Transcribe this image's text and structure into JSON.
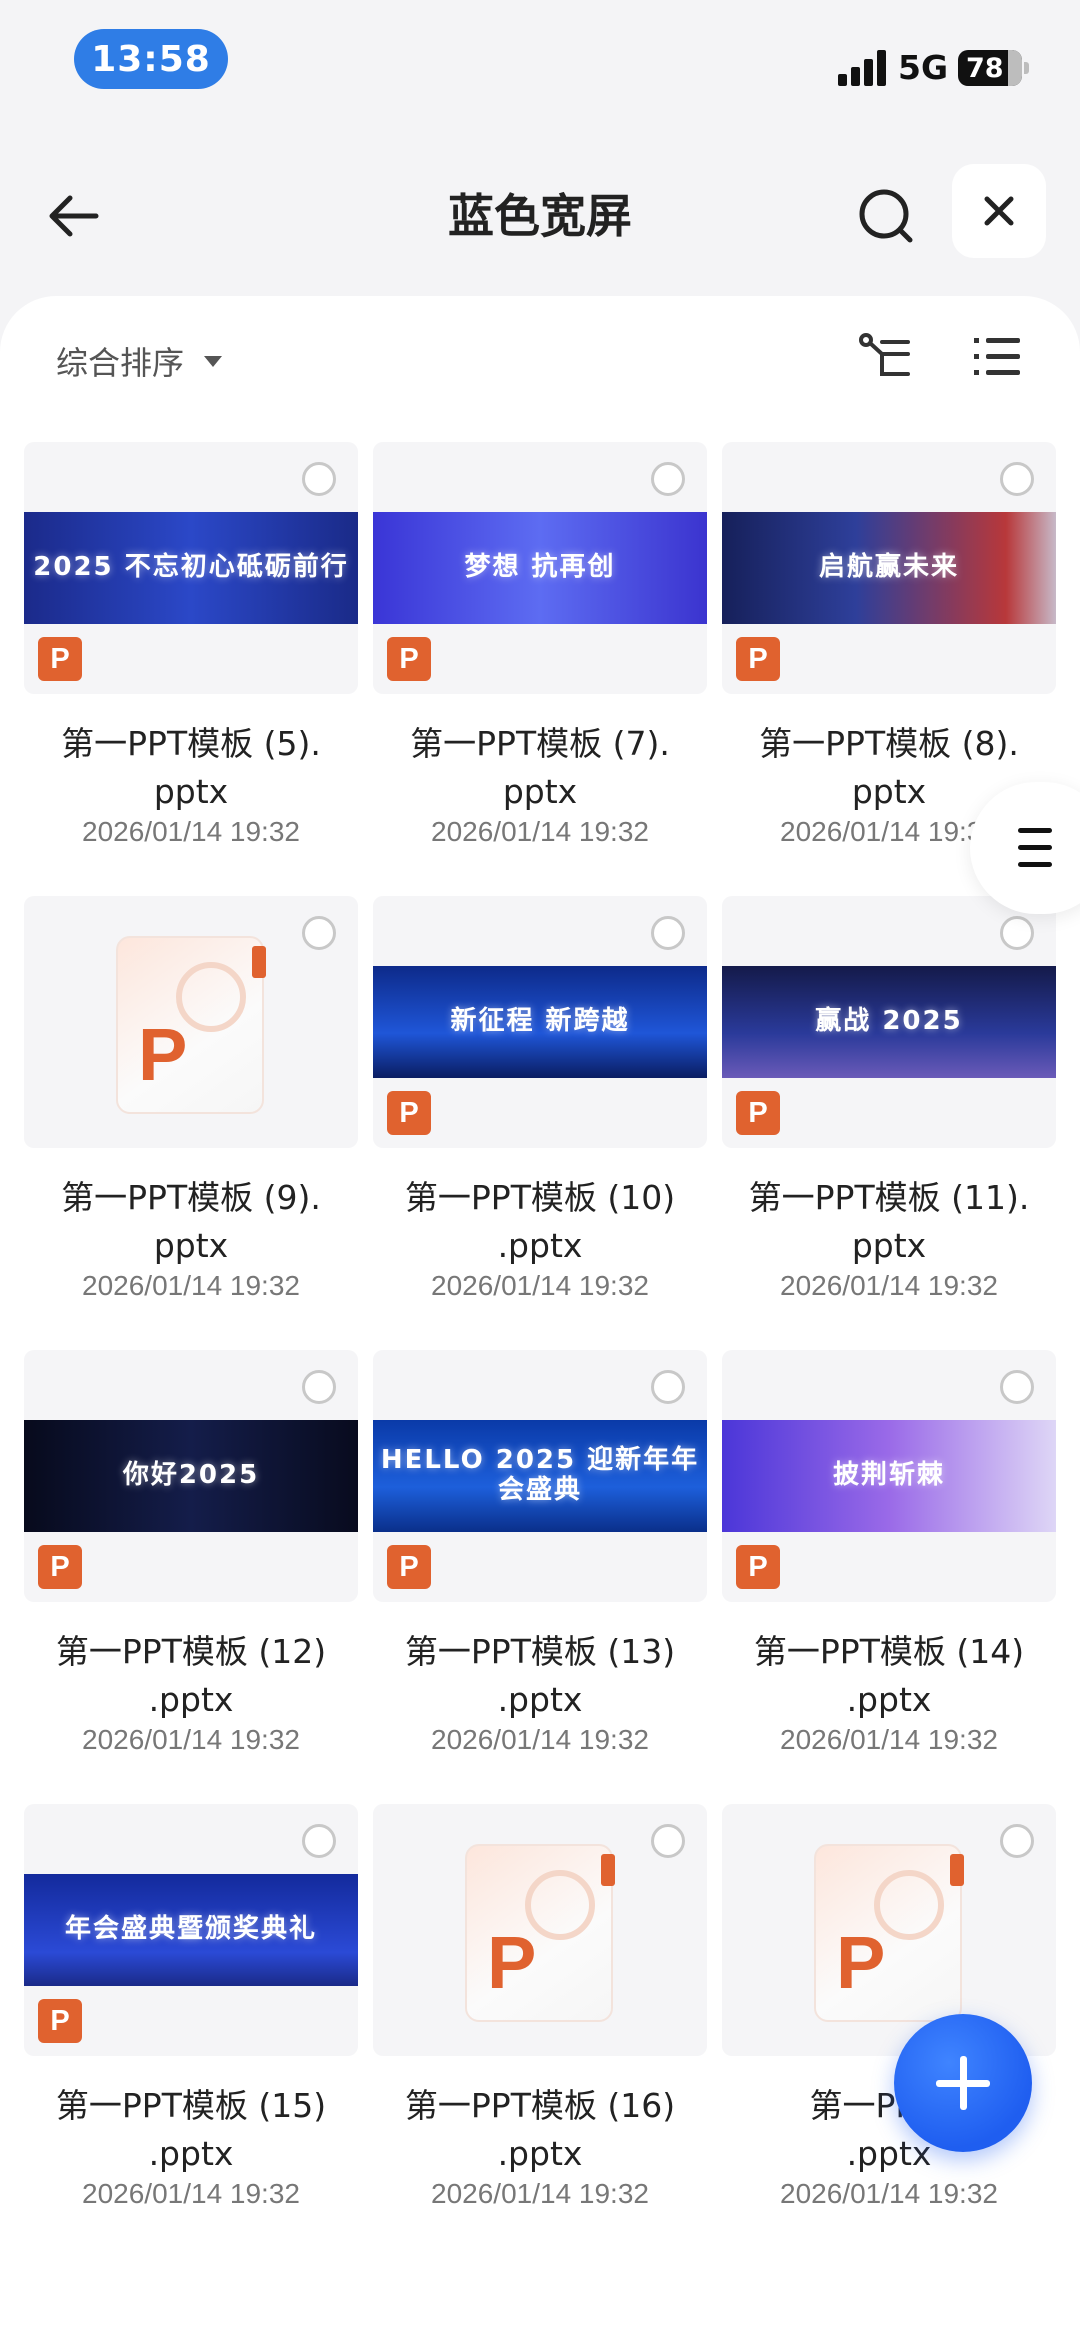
{
  "status": {
    "time": "13:58",
    "network": "5G",
    "battery": "78"
  },
  "header": {
    "title": "蓝色宽屏"
  },
  "toolbar": {
    "sort_label": "综合排序"
  },
  "files": [
    {
      "name": "第一PPT模板 (5).\npptx",
      "date": "2026/01/14 19:32",
      "banner": "2025 不忘初心砥砺前行",
      "style": "b1",
      "type_badge": "P"
    },
    {
      "name": "第一PPT模板 (7).\npptx",
      "date": "2026/01/14 19:32",
      "banner": "梦想 抗再创",
      "style": "b2",
      "type_badge": "P"
    },
    {
      "name": "第一PPT模板 (8).\npptx",
      "date": "2026/01/14 19:32",
      "banner": "启航赢未来",
      "style": "b3",
      "type_badge": "P"
    },
    {
      "name": "第一PPT模板 (9).\npptx",
      "date": "2026/01/14 19:32",
      "banner": "",
      "style": "none",
      "type_badge": ""
    },
    {
      "name": "第一PPT模板 (10)\n.pptx",
      "date": "2026/01/14 19:32",
      "banner": "新征程 新跨越",
      "style": "b5",
      "type_badge": "P"
    },
    {
      "name": "第一PPT模板 (11).\npptx",
      "date": "2026/01/14 19:32",
      "banner": "赢战 2025",
      "style": "b6",
      "type_badge": "P"
    },
    {
      "name": "第一PPT模板 (12)\n.pptx",
      "date": "2026/01/14 19:32",
      "banner": "你好2025",
      "style": "b7",
      "type_badge": "P"
    },
    {
      "name": "第一PPT模板 (13)\n.pptx",
      "date": "2026/01/14 19:32",
      "banner": "HELLO 2025 迎新年年会盛典",
      "style": "b8",
      "type_badge": "P"
    },
    {
      "name": "第一PPT模板 (14)\n.pptx",
      "date": "2026/01/14 19:32",
      "banner": "披荆斩棘",
      "style": "b9",
      "type_badge": "P"
    },
    {
      "name": "第一PPT模板 (15)\n.pptx",
      "date": "2026/01/14 19:32",
      "banner": "年会盛典暨颁奖典礼",
      "style": "b10",
      "type_badge": "P"
    },
    {
      "name": "第一PPT模板 (16)\n.pptx",
      "date": "2026/01/14 19:32",
      "banner": "",
      "style": "none",
      "type_badge": ""
    },
    {
      "name": "第一PPT模\n.pptx",
      "date": "2026/01/14 19:32",
      "banner": "",
      "style": "none",
      "type_badge": ""
    }
  ],
  "icons": {
    "back": "back-arrow-icon",
    "search": "search-icon",
    "close": "close-icon",
    "tree": "tree-view-icon",
    "list": "list-view-icon",
    "menu": "menu-icon",
    "add": "plus-icon"
  },
  "colors": {
    "accent": "#2f7de6",
    "ppt": "#e0622f",
    "fab": "#1f5ef0"
  }
}
